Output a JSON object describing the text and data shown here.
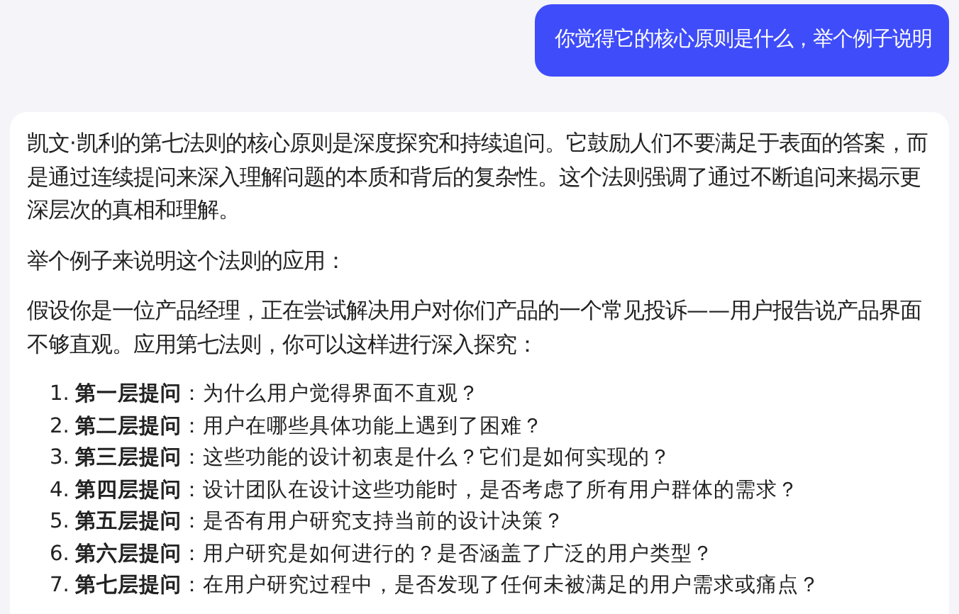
{
  "user_message": {
    "text": "你觉得它的核心原则是什么，举个例子说明"
  },
  "reply": {
    "paragraphs": [
      "凯文·凯利的第七法则的核心原则是深度探究和持续追问。它鼓励人们不要满足于表面的答案，而是通过连续提问来深入理解问题的本质和背后的复杂性。这个法则强调了通过不断追问来揭示更深层次的真相和理解。",
      "举个例子来说明这个法则的应用：",
      "假设你是一位产品经理，正在尝试解决用户对你们产品的一个常见投诉——用户报告说产品界面不够直观。应用第七法则，你可以这样进行深入探究："
    ],
    "list": [
      {
        "number": "1.",
        "text": "**第一层提问**：为什么用户觉得界面不直观？"
      },
      {
        "number": "2.",
        "text": "**第二层提问**：用户在哪些具体功能上遇到了困难？"
      },
      {
        "number": "3.",
        "text": "**第三层提问**：这些功能的设计初衷是什么？它们是如何实现的？"
      },
      {
        "number": "4.",
        "text": "**第四层提问**：设计团队在设计这些功能时，是否考虑了所有用户群体的需求？"
      },
      {
        "number": "5.",
        "text": "**第五层提问**：是否有用户研究支持当前的设计决策？"
      },
      {
        "number": "6.",
        "text": "**第六层提问**：用户研究是如何进行的？是否涵盖了广泛的用户类型？"
      },
      {
        "number": "7.",
        "text": "**第七层提问**：在用户研究过程中，是否发现了任何未被满足的用户需求或痛点？"
      }
    ]
  }
}
